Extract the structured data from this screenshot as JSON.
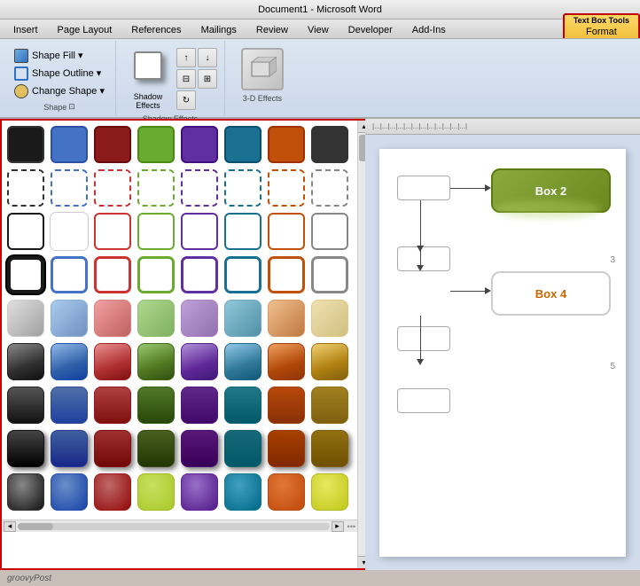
{
  "titlebar": {
    "text": "Document1 - Microsoft Word"
  },
  "tabs": {
    "items": [
      {
        "label": "Insert"
      },
      {
        "label": "Page Layout"
      },
      {
        "label": "References"
      },
      {
        "label": "Mailings"
      },
      {
        "label": "Review"
      },
      {
        "label": "View"
      },
      {
        "label": "Developer"
      },
      {
        "label": "Add-Ins"
      }
    ],
    "special_group": "Text Box Tools",
    "active_tab": "Format"
  },
  "ribbon": {
    "shape_group": {
      "label": "Shape",
      "fill_btn": "Shape Fill ▾",
      "outline_btn": "Shape Outline ▾",
      "change_btn": "Change Shape ▾"
    },
    "shadow_btn": "Shadow\nEffects",
    "shadow_label": "Shadow Effects",
    "effects_3d_label": "3-D\nEffects"
  },
  "shape_styles": {
    "rows": [
      [
        "solid-black",
        "solid-blue",
        "solid-darkred",
        "solid-green",
        "solid-purple",
        "solid-teal",
        "solid-orange"
      ],
      [
        "dashed-white",
        "dashed-blue",
        "dashed-red",
        "dashed-green",
        "dashed-purple",
        "dashed-teal",
        "dashed-orange"
      ],
      [
        "outline-black",
        "outline-white-r",
        "outline-red",
        "outline-green",
        "outline-purple",
        "outline-teal",
        "outline-orange"
      ],
      [
        "thick-black",
        "thick-blue",
        "thick-red",
        "thick-green",
        "thick-purple",
        "thick-teal",
        "thick-orange"
      ],
      [
        "grad-gray",
        "grad-blue",
        "grad-red",
        "grad-green",
        "grad-purple",
        "grad-teal",
        "grad-orange"
      ],
      [
        "gloss-black",
        "gloss-blue",
        "gloss-red",
        "gloss-green",
        "gloss-purple",
        "gloss-teal",
        "gloss-orange"
      ],
      [
        "dark-black",
        "dark-blue",
        "dark-red",
        "dark-green",
        "dark-purple",
        "dark-teal",
        "dark-orange"
      ],
      [
        "dark2-black",
        "dark2-blue",
        "dark2-red",
        "dark2-green",
        "dark2-purple",
        "dark2-teal",
        "dark2-orange"
      ],
      [
        "highlight-black",
        "highlight-blue",
        "highlight-red",
        "highlight-yellow",
        "highlight-purple",
        "highlight-teal",
        "highlight-orange"
      ]
    ]
  },
  "doc": {
    "box2_label": "Box 2",
    "box4_label": "Box 4"
  },
  "watermark": "groovyPost"
}
